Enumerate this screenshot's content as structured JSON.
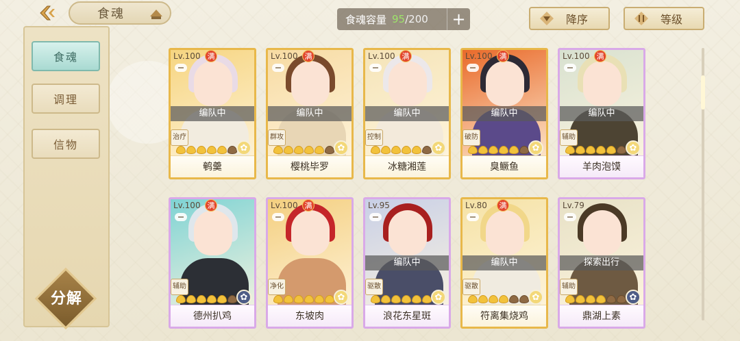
{
  "header": {
    "title": "食魂",
    "capacity_label": "食魂容量",
    "capacity_current": "95",
    "capacity_total": "/200",
    "add_label": "+",
    "sort_order_label": "降序",
    "sort_by_label": "等级"
  },
  "sidebar": {
    "items": [
      {
        "label": "食魂",
        "active": true
      },
      {
        "label": "调理",
        "active": false
      },
      {
        "label": "信物",
        "active": false
      }
    ],
    "decompose_label": "分解"
  },
  "cards": [
    {
      "level": "Lv.100",
      "full": "满",
      "status": "编队中",
      "role": "治疗",
      "name": "鹌羹",
      "flames": 5,
      "frame": "gold",
      "hair": "#e9dbe6",
      "body": "#f2ecdf",
      "bg": "#f6d581",
      "talent": "gold"
    },
    {
      "level": "Lv.100",
      "full": "满",
      "status": "编队中",
      "role": "群攻",
      "name": "樱桃毕罗",
      "flames": 5,
      "frame": "gold",
      "hair": "#7a4a2c",
      "body": "#e8d6b5",
      "bg": "#f7dba3",
      "talent": "gold"
    },
    {
      "level": "Lv.100",
      "full": "满",
      "status": "编队中",
      "role": "控制",
      "name": "冰糖湘莲",
      "flames": 5,
      "frame": "gold",
      "hair": "#ece8ea",
      "body": "#f3eadb",
      "bg": "#f5e4b8",
      "talent": "gold"
    },
    {
      "level": "Lv.100",
      "full": "满",
      "status": "编队中",
      "role": "破防",
      "name": "臭鳜鱼",
      "flames": 5,
      "frame": "gold",
      "hair": "#2d2a35",
      "body": "#5b4a8a",
      "bg": "#e96a2a",
      "talent": "gold"
    },
    {
      "level": "Lv.100",
      "full": "满",
      "status": "编队中",
      "role": "辅助",
      "name": "羊肉泡馍",
      "flames": 5,
      "frame": "purple",
      "hair": "#e9e0b5",
      "body": "#4d4433",
      "bg": "#d8e1d0",
      "talent": "gold"
    },
    {
      "level": "Lv.100",
      "full": "满",
      "status": "",
      "role": "辅助",
      "name": "德州扒鸡",
      "flames": 5,
      "frame": "purple",
      "hair": "#dfe7ec",
      "body": "#2c2f35",
      "bg": "#7fd3d4",
      "talent": "blue"
    },
    {
      "level": "Lv.100",
      "full": "满",
      "status": "",
      "role": "净化",
      "name": "东坡肉",
      "flames": 6,
      "frame": "purple",
      "hair": "#c5262a",
      "body": "#d49a6d",
      "bg": "#f4cf80",
      "talent": "gold"
    },
    {
      "level": "Lv.95",
      "full": "",
      "status": "编队中",
      "role": "驱散",
      "name": "浪花东星斑",
      "flames": 6,
      "frame": "purple",
      "hair": "#a8201f",
      "body": "#4a4e68",
      "bg": "#c8cfe6",
      "talent": "gold"
    },
    {
      "level": "Lv.80",
      "full": "满",
      "status": "编队中",
      "role": "驱散",
      "name": "符离集烧鸡",
      "flames": 4,
      "frame": "gold",
      "hair": "#f1d789",
      "body": "#f0ebe0",
      "bg": "#f5e2a6",
      "talent": "gold"
    },
    {
      "level": "Lv.79",
      "full": "",
      "status": "探索出行",
      "role": "辅助",
      "name": "鼎湖上素",
      "flames": 4,
      "frame": "purple",
      "hair": "#4b3a26",
      "body": "#6e5a42",
      "bg": "#e7e1c6",
      "talent": "blue"
    }
  ]
}
